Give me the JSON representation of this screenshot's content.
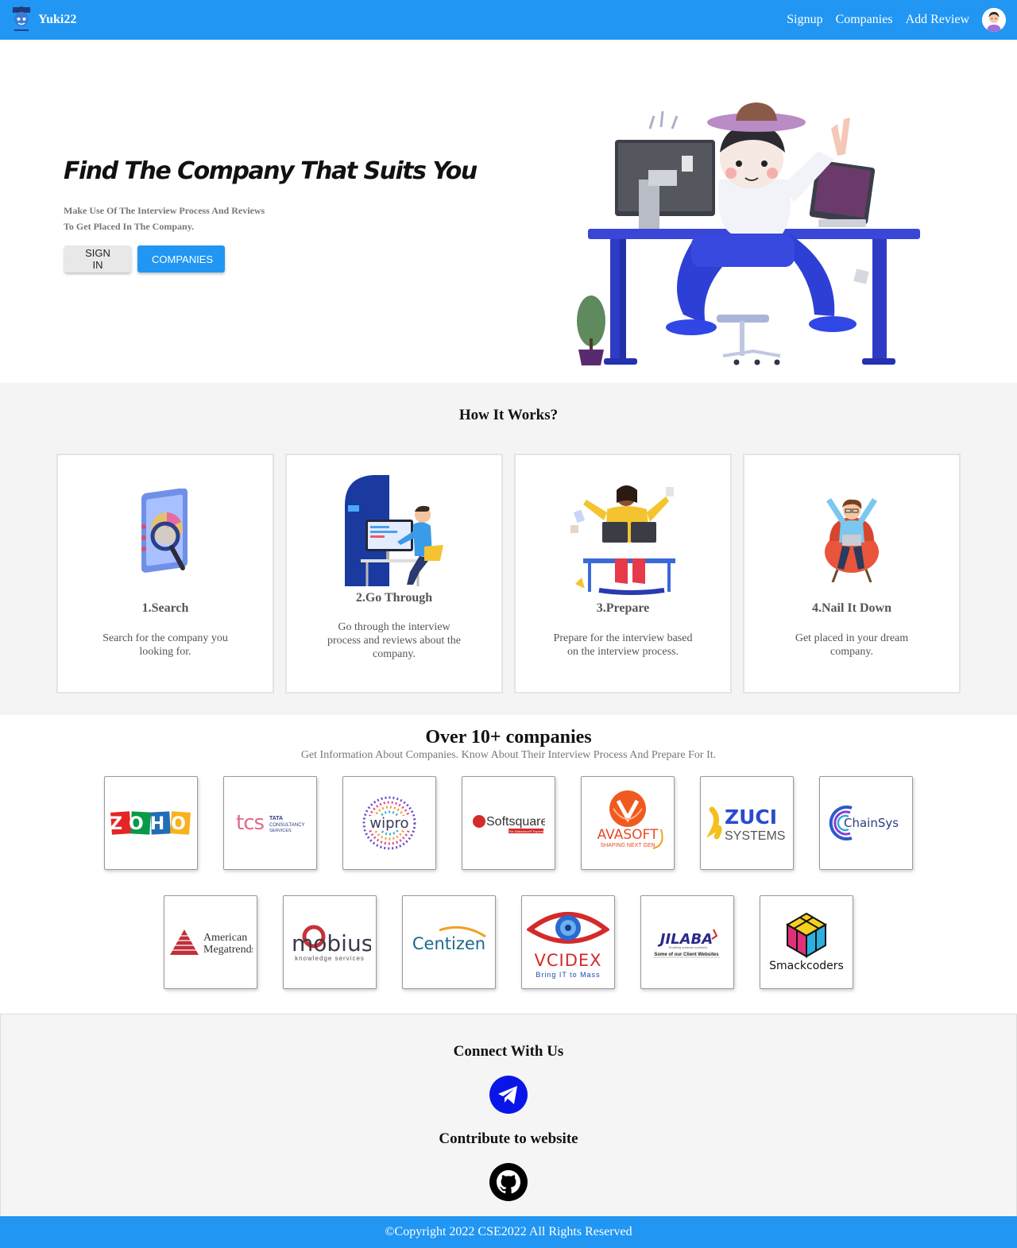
{
  "nav": {
    "brand": "Yuki22",
    "links": [
      "Signup",
      "Companies",
      "Add Review"
    ],
    "avatar_icon": "user-avatar-icon"
  },
  "hero": {
    "title": "Find The Company That Suits You",
    "subtitle_line1": "Make Use Of The Interview Process And Reviews",
    "subtitle_line2": "To Get Placed In The Company.",
    "signin_label": "SIGN IN",
    "companies_label": "COMPANIES"
  },
  "how": {
    "title": "How It Works?",
    "steps": [
      {
        "title": "1.Search",
        "desc": "Search for the company you looking for.",
        "icon": "search-report-icon"
      },
      {
        "title": "2.Go Through",
        "desc": "Go through the interview process and reviews about the company.",
        "icon": "computer-user-icon"
      },
      {
        "title": "3.Prepare",
        "desc": "Prepare for the interview based on the interview process.",
        "icon": "busy-desk-icon"
      },
      {
        "title": "4.Nail It Down",
        "desc": "Get placed in your dream company.",
        "icon": "happy-chair-icon"
      }
    ]
  },
  "companies": {
    "title": "Over 10+ companies",
    "subtitle": "Get Information About Companies. Know About Their Interview Process And Prepare For It.",
    "row1": [
      "ZOHO",
      "tcs",
      "wipro",
      "Softsquare",
      "AVASOFT",
      "ZUCI SYSTEMS",
      "ChainSys"
    ],
    "row2": [
      "American Megatrends",
      "mobius",
      "Centizen",
      "VCIDEX",
      "JILABA",
      "Smackcoders"
    ],
    "logo_text": {
      "zoho": "ZOHO",
      "tcs": "tcs",
      "tcs_sub1": "TATA",
      "tcs_sub2": "CONSULTANCY",
      "tcs_sub3": "SERVICES",
      "wipro": "wipro",
      "softsquare": "Softsquare",
      "softsquare_tag": "The Salesforce® Experts",
      "avasoft": "AVASOFT",
      "avasoft_tag": "SHAPING NEXT GEN",
      "zuci1": "ZUCI",
      "zuci2": "SYSTEMS",
      "chainsys": "ChainSys",
      "ami1": "American",
      "ami2": "Megatrends",
      "mobius": "mobius",
      "mobius_tag": "knowledge services",
      "centizen": "Centizen",
      "vcidex": "VCIDEX",
      "vcidex_tag": "Bring IT to Mass",
      "jilaba": "JILABA",
      "jilaba_tag": "Enabling software solutions",
      "jilaba_sub": "Some of our Client Websites",
      "smack": "Smackcoders"
    }
  },
  "connect": {
    "title": "Connect With Us",
    "contribute_title": "Contribute to website"
  },
  "footer": {
    "text": "©Copyright 2022 CSE2022 All Rights Reserved"
  },
  "colors": {
    "primary": "#2196f3",
    "telegram": "#0a16e8",
    "section_bg": "#f4f4f4"
  }
}
